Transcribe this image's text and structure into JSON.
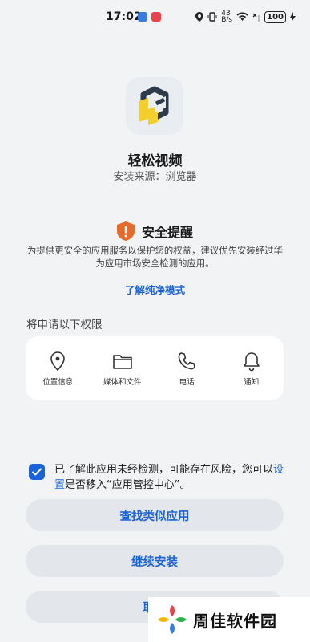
{
  "status_bar": {
    "time": "17:02",
    "network_speed_top": "43",
    "network_speed_bottom": "B/s",
    "battery": "100"
  },
  "app": {
    "name": "轻松视频",
    "source_label": "安装来源：",
    "source_value": "浏览器"
  },
  "safety": {
    "title": "安全提醒",
    "body": "为提供更安全的应用服务以保护您的权益，建议优先安装经过华为应用市场安全检测的应用。",
    "learn_more": "了解纯净模式"
  },
  "permissions": {
    "title": "将申请以下权限",
    "items": [
      {
        "label": "位置信息",
        "icon": "location-pin-icon"
      },
      {
        "label": "媒体和文件",
        "icon": "folder-icon"
      },
      {
        "label": "电话",
        "icon": "phone-icon"
      },
      {
        "label": "通知",
        "icon": "bell-icon"
      }
    ]
  },
  "consent": {
    "checked": true,
    "text_before": "已了解此应用未经检测，可能存在风险，您可以",
    "link": "设置",
    "text_after": "是否移入“应用管控中心”。"
  },
  "buttons": {
    "find_similar": "查找类似应用",
    "continue_install": "继续安装",
    "cancel": "取消"
  },
  "watermark": {
    "text": "周佳软件园"
  },
  "colors": {
    "accent": "#1b63d9",
    "background": "#f1f3f5",
    "warning": "#e86a2b"
  }
}
